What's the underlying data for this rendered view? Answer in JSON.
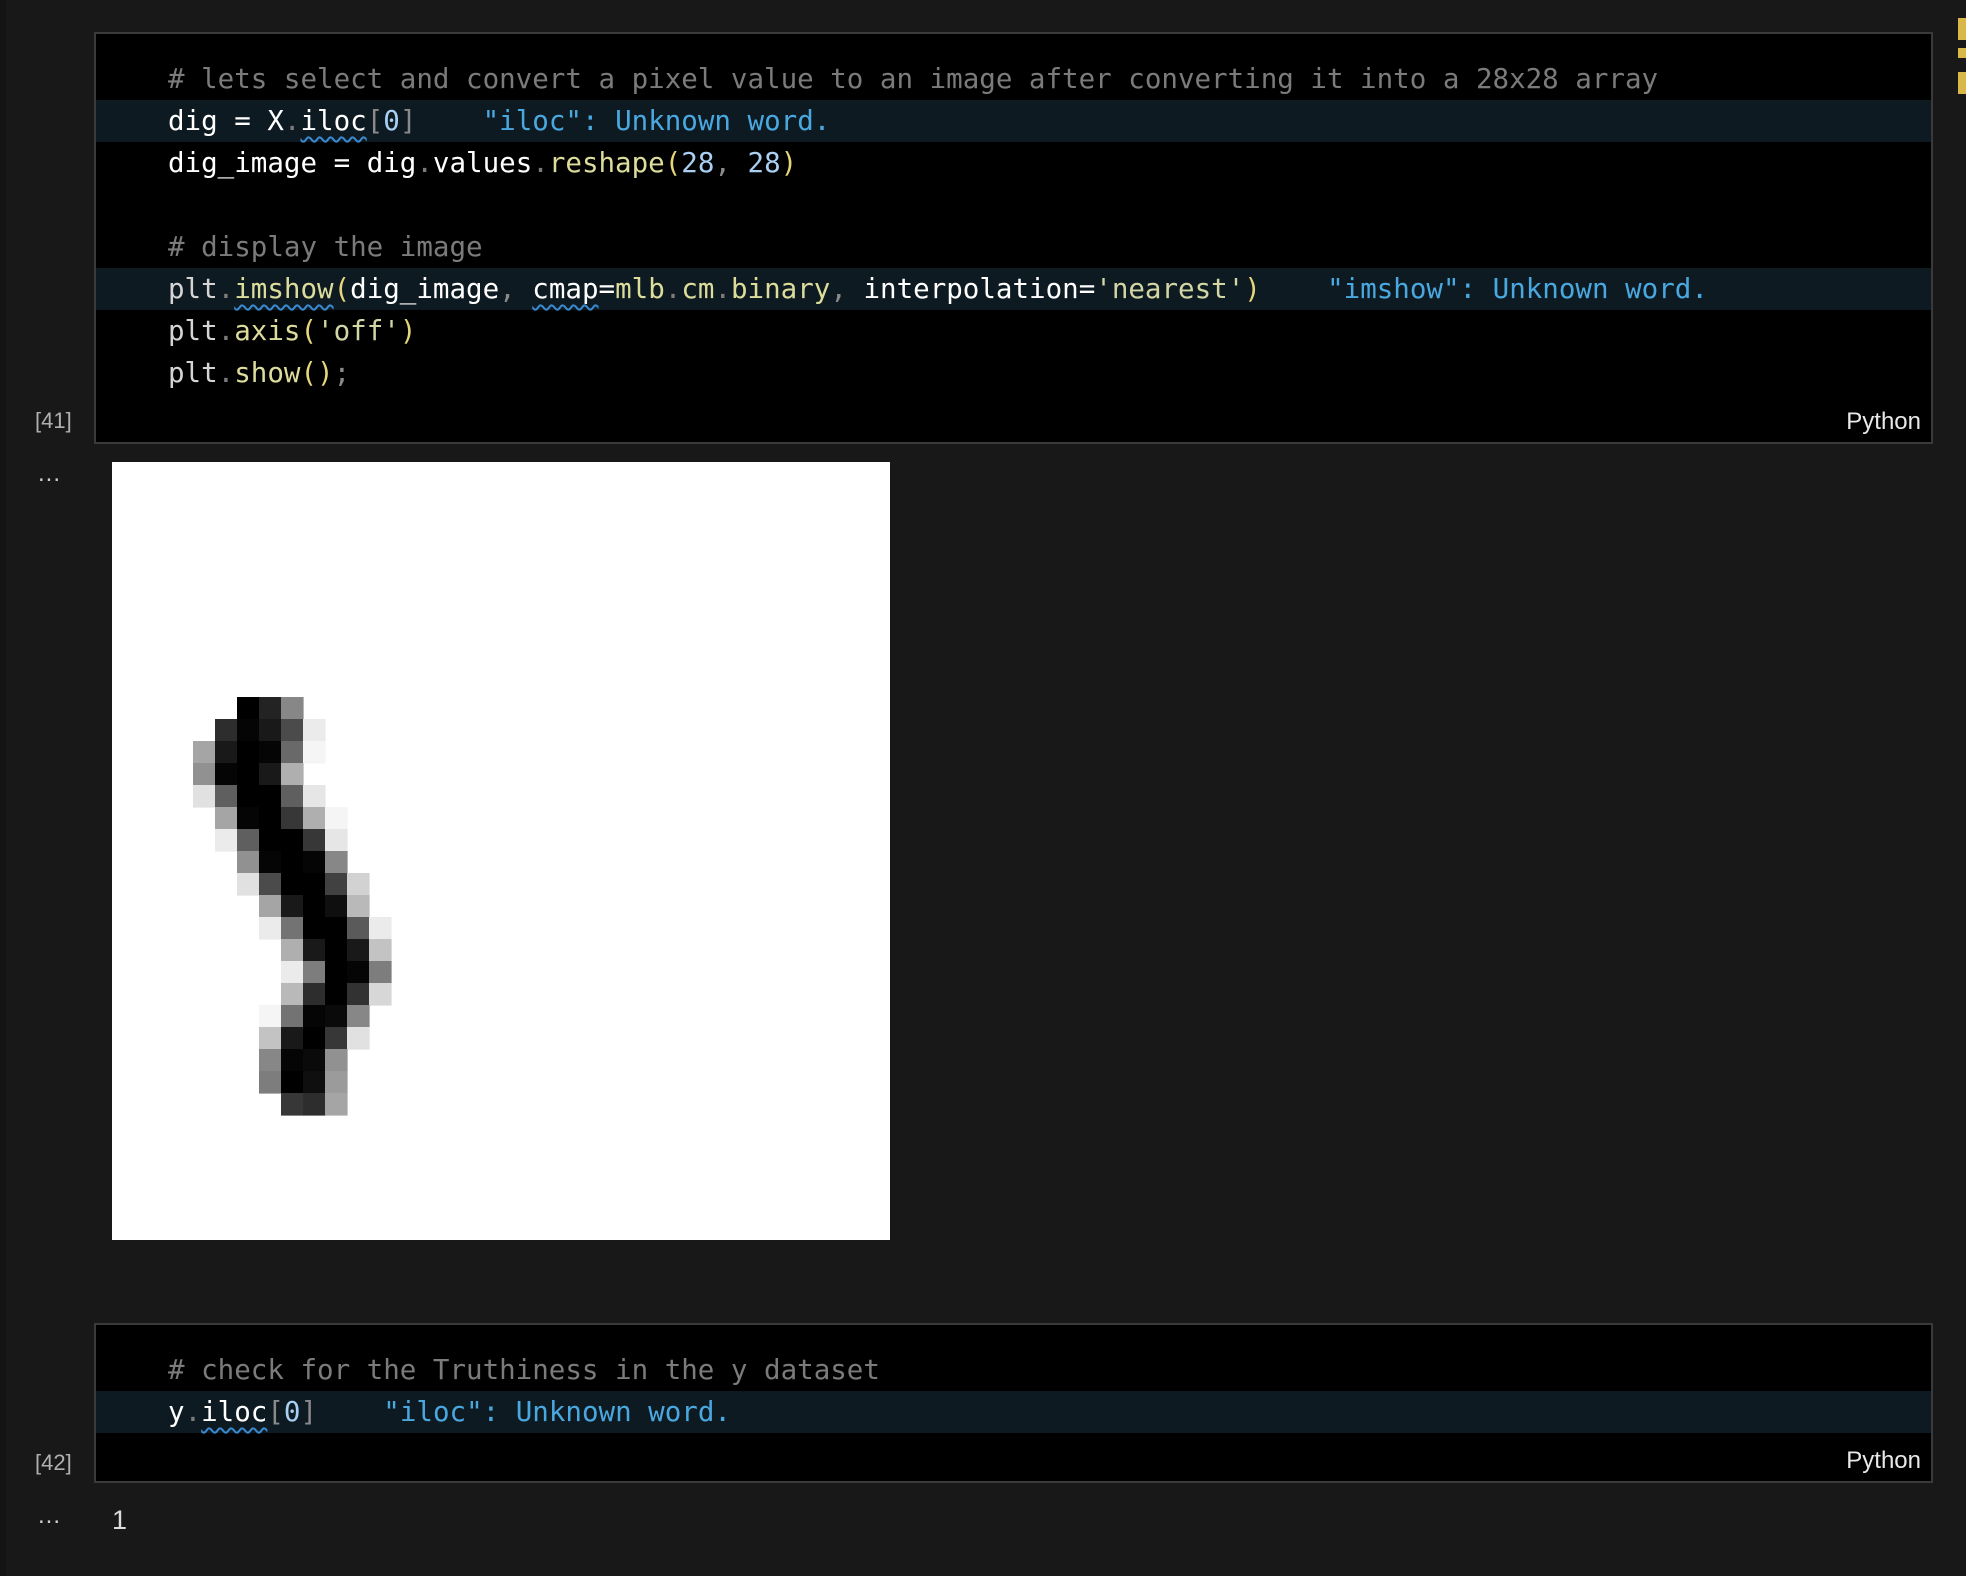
{
  "cells": [
    {
      "exec_count": "[41]",
      "language": "Python",
      "lines": [
        {
          "comment": "# lets select and convert a pixel value to an image after converting it into a 28x28 array"
        },
        {
          "t0": "dig",
          "t1": " = ",
          "t2": "X",
          "t3": ".",
          "t4": "iloc",
          "t5": "[",
          "t6": "0",
          "t7": "]",
          "diag": "\"iloc\": Unknown word."
        },
        {
          "t0": "dig_image",
          "t1": " = ",
          "t2": "dig",
          "t3": ".",
          "t4": "values",
          "t5": ".",
          "t6": "reshape",
          "t7": "(",
          "t8": "28",
          "t9": ", ",
          "t10": "28",
          "t11": ")"
        },
        {
          "comment": ""
        },
        {
          "comment": "# display the image"
        },
        {
          "t0": "plt",
          "t1": ".",
          "t2": "imshow",
          "t3": "(",
          "t4": "dig_image",
          "t5": ", ",
          "t6": "cmap",
          "t7": "=",
          "t8": "mlb",
          "t9": ".",
          "t10": "cm",
          "t11": ".",
          "t12": "binary",
          "t13": ", ",
          "t14": "interpolation",
          "t15": "=",
          "t16": "'nearest'",
          "t17": ")",
          "diag": "\"imshow\": Unknown word."
        },
        {
          "t0": "plt",
          "t1": ".",
          "t2": "axis",
          "t3": "(",
          "t4": "'off'",
          "t5": ")"
        },
        {
          "t0": "plt",
          "t1": ".",
          "t2": "show",
          "t3": "()",
          "t4": ";"
        }
      ],
      "output_ellipsis": "..."
    },
    {
      "exec_count": "[42]",
      "language": "Python",
      "lines": [
        {
          "comment": "# check for the Truthiness in the y dataset"
        },
        {
          "t0": "y",
          "t1": ".",
          "t2": "iloc",
          "t3": "[",
          "t4": "0",
          "t5": "]",
          "diag": "\"iloc\": Unknown word."
        }
      ],
      "output_ellipsis": "...",
      "output_text": "1"
    }
  ],
  "digit_image": {
    "size": 28,
    "colormap": "binary",
    "pixels": [
      [
        7,
        2,
        255
      ],
      [
        7,
        3,
        220
      ],
      [
        7,
        4,
        120
      ],
      [
        8,
        1,
        210
      ],
      [
        8,
        2,
        250
      ],
      [
        8,
        3,
        230
      ],
      [
        8,
        4,
        180
      ],
      [
        8,
        5,
        20
      ],
      [
        9,
        0,
        90
      ],
      [
        9,
        1,
        230
      ],
      [
        9,
        2,
        255
      ],
      [
        9,
        3,
        250
      ],
      [
        9,
        4,
        150
      ],
      [
        9,
        5,
        10
      ],
      [
        10,
        0,
        110
      ],
      [
        10,
        1,
        250
      ],
      [
        10,
        2,
        255
      ],
      [
        10,
        3,
        230
      ],
      [
        10,
        4,
        80
      ],
      [
        11,
        0,
        30
      ],
      [
        11,
        1,
        160
      ],
      [
        11,
        2,
        255
      ],
      [
        11,
        3,
        255
      ],
      [
        11,
        4,
        160
      ],
      [
        11,
        5,
        25
      ],
      [
        12,
        1,
        90
      ],
      [
        12,
        2,
        250
      ],
      [
        12,
        3,
        255
      ],
      [
        12,
        4,
        200
      ],
      [
        12,
        5,
        80
      ],
      [
        12,
        6,
        10
      ],
      [
        13,
        1,
        20
      ],
      [
        13,
        2,
        160
      ],
      [
        13,
        3,
        255
      ],
      [
        13,
        4,
        255
      ],
      [
        13,
        5,
        200
      ],
      [
        13,
        6,
        25
      ],
      [
        14,
        2,
        110
      ],
      [
        14,
        3,
        250
      ],
      [
        14,
        4,
        255
      ],
      [
        14,
        5,
        250
      ],
      [
        14,
        6,
        120
      ],
      [
        15,
        2,
        30
      ],
      [
        15,
        3,
        180
      ],
      [
        15,
        4,
        255
      ],
      [
        15,
        5,
        255
      ],
      [
        15,
        6,
        190
      ],
      [
        15,
        7,
        45
      ],
      [
        16,
        3,
        90
      ],
      [
        16,
        4,
        230
      ],
      [
        16,
        5,
        255
      ],
      [
        16,
        6,
        240
      ],
      [
        16,
        7,
        70
      ],
      [
        17,
        3,
        20
      ],
      [
        17,
        4,
        140
      ],
      [
        17,
        5,
        255
      ],
      [
        17,
        6,
        255
      ],
      [
        17,
        7,
        165
      ],
      [
        17,
        8,
        20
      ],
      [
        18,
        4,
        80
      ],
      [
        18,
        5,
        230
      ],
      [
        18,
        6,
        255
      ],
      [
        18,
        7,
        230
      ],
      [
        18,
        8,
        60
      ],
      [
        19,
        4,
        20
      ],
      [
        19,
        5,
        130
      ],
      [
        19,
        6,
        255
      ],
      [
        19,
        7,
        250
      ],
      [
        19,
        8,
        130
      ],
      [
        20,
        4,
        70
      ],
      [
        20,
        5,
        210
      ],
      [
        20,
        6,
        255
      ],
      [
        20,
        7,
        205
      ],
      [
        20,
        8,
        40
      ],
      [
        21,
        3,
        10
      ],
      [
        21,
        4,
        140
      ],
      [
        21,
        5,
        250
      ],
      [
        21,
        6,
        245
      ],
      [
        21,
        7,
        120
      ],
      [
        22,
        3,
        60
      ],
      [
        22,
        4,
        230
      ],
      [
        22,
        5,
        255
      ],
      [
        22,
        6,
        200
      ],
      [
        22,
        7,
        30
      ],
      [
        23,
        3,
        120
      ],
      [
        23,
        4,
        250
      ],
      [
        23,
        5,
        245
      ],
      [
        23,
        6,
        110
      ],
      [
        24,
        3,
        130
      ],
      [
        24,
        4,
        255
      ],
      [
        24,
        5,
        240
      ],
      [
        24,
        6,
        100
      ],
      [
        25,
        4,
        200
      ],
      [
        25,
        5,
        210
      ],
      [
        25,
        6,
        90
      ]
    ]
  }
}
